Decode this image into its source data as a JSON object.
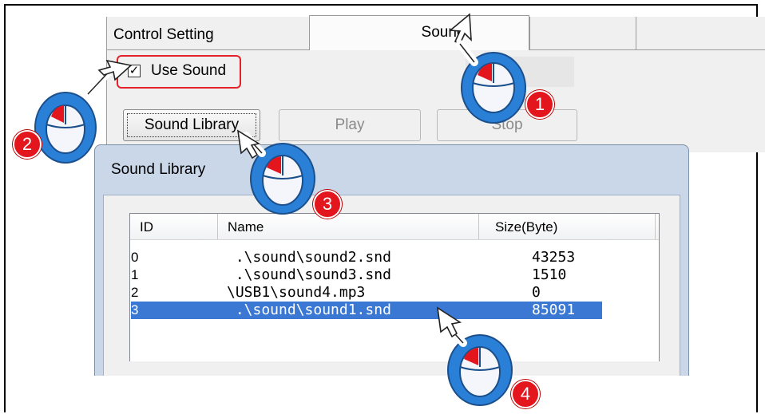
{
  "tabs": [
    {
      "label": "Control Setting"
    },
    {
      "label": "Sound"
    }
  ],
  "use_sound": {
    "label": "Use Sound",
    "checked": true
  },
  "buttons": {
    "sound_library": "Sound Library",
    "play": "Play",
    "stop": "Stop"
  },
  "library_window": {
    "title": "Sound Library",
    "columns": [
      "ID",
      "Name",
      "Size(Byte)"
    ],
    "rows": [
      {
        "id": "0",
        "name": " .\\sound\\sound2.snd",
        "size": "43253"
      },
      {
        "id": "1",
        "name": " .\\sound\\sound3.snd",
        "size": "1510"
      },
      {
        "id": "2",
        "name": "\\USB1\\sound4.mp3",
        "size": "0"
      },
      {
        "id": "3",
        "name": " .\\sound\\sound1.snd",
        "size": "85091",
        "selected": true
      }
    ]
  },
  "steps": [
    "1",
    "2",
    "3",
    "4"
  ],
  "colors": {
    "accent_red": "#e3151d",
    "cursor_blue": "#2a7fd6",
    "selection": "#3b78d4"
  }
}
